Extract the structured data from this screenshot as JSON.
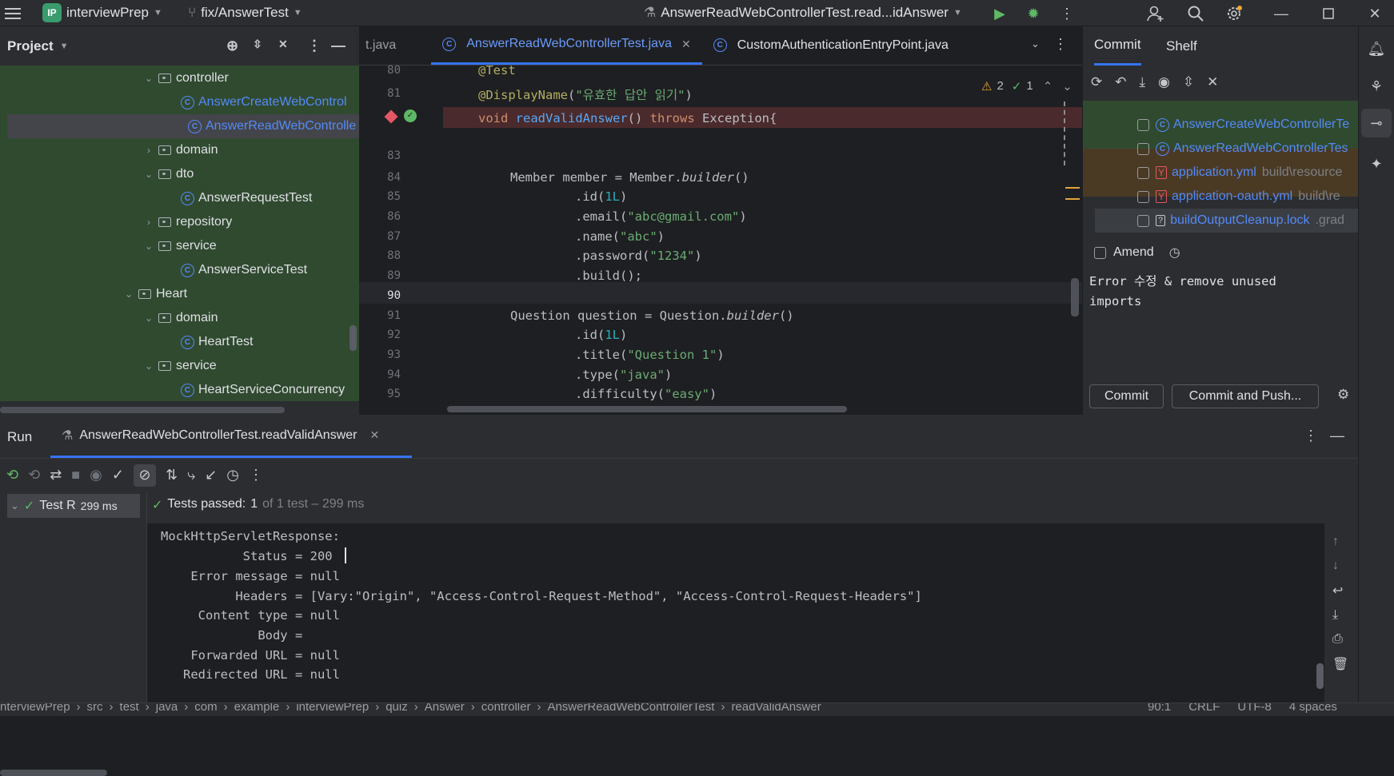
{
  "titlebar": {
    "project_badge": "IP",
    "project_name": "interviewPrep",
    "branch": "fix/AnswerTest",
    "run_config": "AnswerReadWebControllerTest.read...idAnswer"
  },
  "project_panel": {
    "title": "Project",
    "tree": [
      {
        "label": "controller",
        "kind": "folder"
      },
      {
        "label": "AnswerCreateWebControl",
        "kind": "class"
      },
      {
        "label": "AnswerReadWebControlle",
        "kind": "class"
      },
      {
        "label": "domain",
        "kind": "folder"
      },
      {
        "label": "dto",
        "kind": "folder"
      },
      {
        "label": "AnswerRequestTest",
        "kind": "class"
      },
      {
        "label": "repository",
        "kind": "folder"
      },
      {
        "label": "service",
        "kind": "folder"
      },
      {
        "label": "AnswerServiceTest",
        "kind": "class"
      },
      {
        "label": "Heart",
        "kind": "folder"
      },
      {
        "label": "domain",
        "kind": "folder"
      },
      {
        "label": "HeartTest",
        "kind": "class"
      },
      {
        "label": "service",
        "kind": "folder"
      },
      {
        "label": "HeartServiceConcurrency",
        "kind": "class"
      }
    ]
  },
  "editor": {
    "tabs": [
      {
        "label": "t.java"
      },
      {
        "label": "AnswerReadWebControllerTest.java"
      },
      {
        "label": "CustomAuthenticationEntryPoint.java"
      }
    ],
    "warnings": "2",
    "checks": "1",
    "line_numbers": [
      "80",
      "81",
      "",
      "83",
      "84",
      "85",
      "86",
      "87",
      "88",
      "89",
      "90",
      "91",
      "92",
      "93",
      "94",
      "95"
    ],
    "top_line": "@Test",
    "annotation": "@DisplayName",
    "display_name": "\"유효한 답안 읽기\"",
    "method_kw": "void",
    "method_name": "readValidAnswer",
    "throws_kw": "throws",
    "exception": "Exception{",
    "line84_a": "Member member = Member.",
    "line84_b": "builder",
    "line84_c": "()",
    "line85_a": ".id(",
    "line85_b": "1L",
    "line85_c": ")",
    "line86_a": ".email(",
    "line86_b": "\"abc@gmail.com\"",
    "line86_c": ")",
    "line87_a": ".name(",
    "line87_b": "\"abc\"",
    "line87_c": ")",
    "line88_a": ".password(",
    "line88_b": "\"1234\"",
    "line88_c": ")",
    "line89": ".build();",
    "line91_a": "Question question = Question.",
    "line91_b": "builder",
    "line91_c": "()",
    "line92_a": ".id(",
    "line92_b": "1L",
    "line92_c": ")",
    "line93_a": ".title(",
    "line93_b": "\"Question 1\"",
    "line93_c": ")",
    "line94_a": ".type(",
    "line94_b": "\"java\"",
    "line94_c": ")",
    "line95_a": ".difficulty(",
    "line95_b": "\"easy\"",
    "line95_c": ")"
  },
  "commit_panel": {
    "tabs": [
      "Commit",
      "Shelf"
    ],
    "files": [
      {
        "name": "AnswerCreateWebControllerTe",
        "path": "",
        "type": "class"
      },
      {
        "name": "AnswerReadWebControllerTes",
        "path": "",
        "type": "class"
      },
      {
        "name": "application.yml",
        "path": "build\\resource",
        "type": "yml"
      },
      {
        "name": "application-oauth.yml",
        "path": "build\\re",
        "type": "yml"
      },
      {
        "name": "buildOutputCleanup.lock",
        "path": ".grad",
        "type": "unknown"
      }
    ],
    "amend_label": "Amend",
    "message_line1": "Error 수정 & remove unused",
    "message_line2": "imports",
    "commit_button": "Commit",
    "commit_push_button": "Commit and Push..."
  },
  "run_panel": {
    "title": "Run",
    "tab_label": "AnswerReadWebControllerTest.readValidAnswer",
    "tree_item": "Test R",
    "tree_time": "299 ms",
    "result_label": "Tests passed:",
    "result_count": "1",
    "result_detail": "of 1 test – 299 ms",
    "console": [
      "MockHttpServletResponse:",
      "           Status = 200",
      "    Error message = null",
      "          Headers = [Vary:\"Origin\", \"Access-Control-Request-Method\", \"Access-Control-Request-Headers\"]",
      "     Content type = null",
      "             Body = ",
      "    Forwarded URL = null",
      "   Redirected URL = null"
    ]
  },
  "statusbar": {
    "breadcrumbs": [
      "nterviewPrep",
      "src",
      "test",
      "java",
      "com",
      "example",
      "interviewPrep",
      "quiz",
      "Answer",
      "controller",
      "AnswerReadWebControllerTest",
      "readValidAnswer"
    ],
    "position": "90:1",
    "line_sep": "CRLF",
    "encoding": "UTF-8",
    "indent": "4 spaces"
  },
  "colors": {
    "accent": "#3574f0",
    "success": "#5fb865",
    "error": "#e55765",
    "string": "#6aab73",
    "keyword": "#cf8e6d"
  }
}
